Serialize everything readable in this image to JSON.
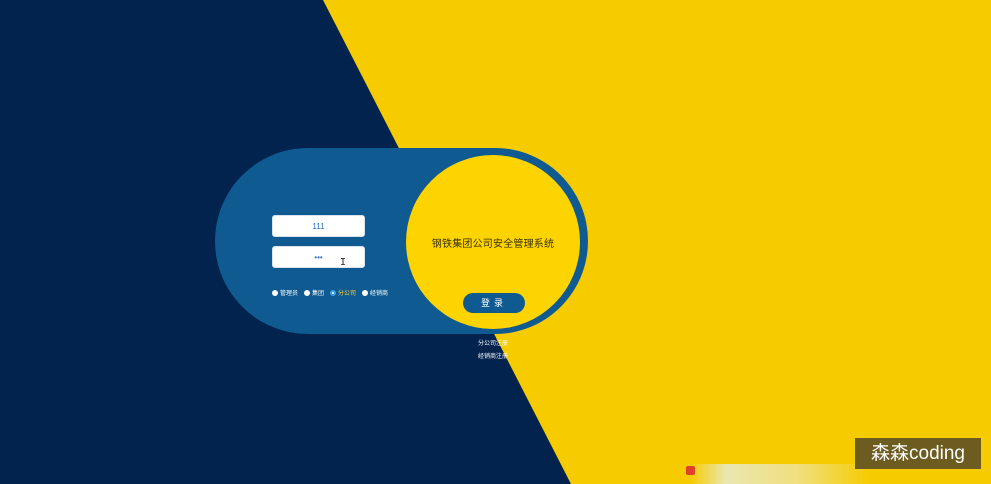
{
  "login": {
    "system_title": "钢铁集团公司安全管理系统",
    "username_value": "111",
    "password_value": "•••",
    "login_label": "登录",
    "roles": [
      {
        "label": "管理员",
        "selected": false
      },
      {
        "label": "集团",
        "selected": false
      },
      {
        "label": "分公司",
        "selected": true
      },
      {
        "label": "经销商",
        "selected": false
      }
    ],
    "links": {
      "branch_register": "分公司注册",
      "dealer_register": "经销商注册"
    }
  },
  "watermark": "森森coding",
  "colors": {
    "yellow_bg": "#f6cb00",
    "navy_bg": "#02234e",
    "panel_blue": "#0e5a91",
    "circle_yellow": "#fdd400"
  },
  "icons": {
    "text_cursor": "i-beam-cursor-icon",
    "radio": "radio-dot-icon"
  }
}
